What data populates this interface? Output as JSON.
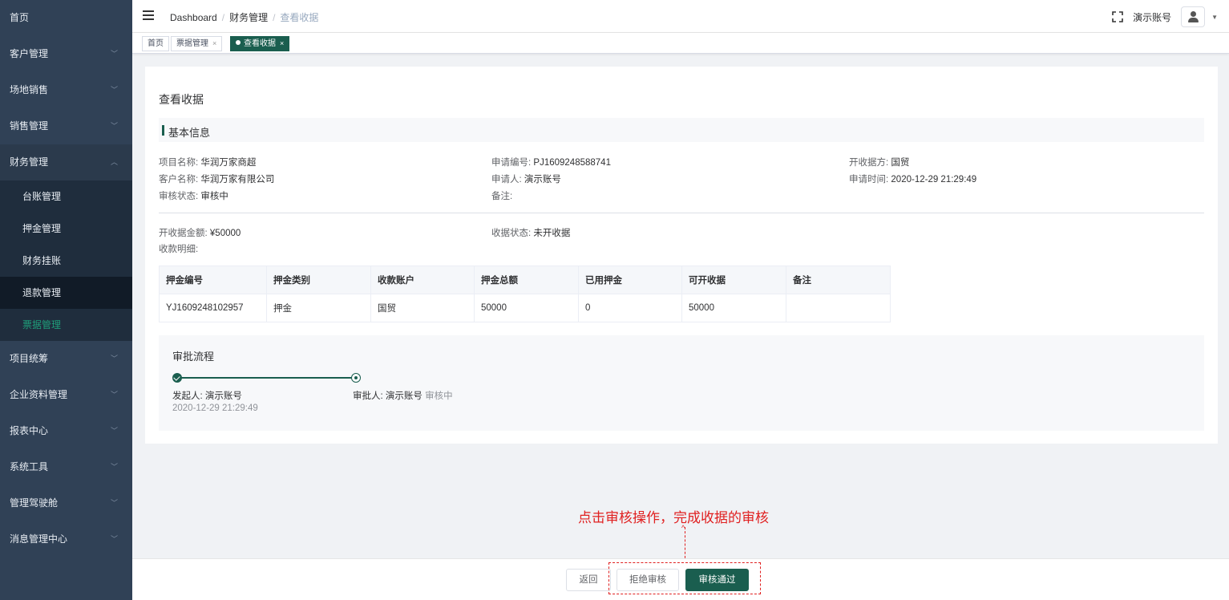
{
  "sidebar": {
    "items": [
      {
        "label": "首页",
        "chev": ""
      },
      {
        "label": "客户管理",
        "chev": "﹀"
      },
      {
        "label": "场地销售",
        "chev": "﹀"
      },
      {
        "label": "销售管理",
        "chev": "﹀"
      },
      {
        "label": "财务管理",
        "chev": "︿"
      },
      {
        "label": "项目统筹",
        "chev": "﹀"
      },
      {
        "label": "企业资料管理",
        "chev": "﹀"
      },
      {
        "label": "报表中心",
        "chev": "﹀"
      },
      {
        "label": "系统工具",
        "chev": "﹀"
      },
      {
        "label": "管理驾驶舱",
        "chev": "﹀"
      },
      {
        "label": "消息管理中心",
        "chev": "﹀"
      }
    ],
    "finance_sub": [
      "台账管理",
      "押金管理",
      "财务挂账",
      "退款管理",
      "票据管理"
    ]
  },
  "header": {
    "breadcrumb": [
      "Dashboard",
      "财务管理",
      "查看收据"
    ],
    "account": "演示账号",
    "caret": "▼"
  },
  "tags": [
    {
      "label": "首页"
    },
    {
      "label": "票据管理",
      "close": "×"
    },
    {
      "label": "查看收据",
      "close": "×"
    }
  ],
  "page": {
    "title": "查看收据",
    "section": "基本信息",
    "fields": {
      "project_label": "项目名称:",
      "project": "华润万家商超",
      "apply_no_label": "申请编号:",
      "apply_no": "PJ1609248588741",
      "issuer_label": "开收据方:",
      "issuer": "国贸",
      "customer_label": "客户名称:",
      "customer": "华润万家有限公司",
      "applicant_label": "申请人:",
      "applicant": "演示账号",
      "apply_time_label": "申请时间:",
      "apply_time": "2020-12-29 21:29:49",
      "audit_status_label": "审核状态:",
      "audit_status": "审核中",
      "remark_label": "备注:",
      "amount_label": "开收据金额:",
      "amount": "¥50000",
      "receipt_status_label": "收据状态:",
      "receipt_status": "未开收据",
      "detail_label": "收款明细:"
    },
    "table": {
      "headers": [
        "押金编号",
        "押金类别",
        "收款账户",
        "押金总额",
        "已用押金",
        "可开收据",
        "备注"
      ],
      "rows": [
        [
          "YJ1609248102957",
          "押金",
          "国贸",
          "50000",
          "0",
          "50000",
          ""
        ]
      ]
    },
    "flow": {
      "title": "审批流程",
      "initiator": "发起人: 演示账号",
      "initiator_time": "2020-12-29 21:29:49",
      "approver": "审批人: 演示账号",
      "approver_status": "审核中"
    }
  },
  "footer": {
    "back": "返回",
    "reject": "拒绝审核",
    "approve": "审核通过"
  },
  "annotation": {
    "text": "点击审核操作，完成收据的审核",
    "arrow": "^"
  },
  "colors": {
    "sidebar": "#304156",
    "primary": "#1a5e4f",
    "annotation": "#e02020"
  }
}
